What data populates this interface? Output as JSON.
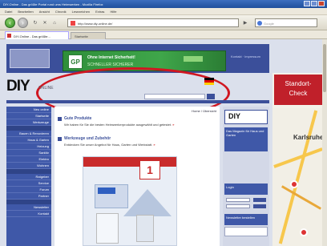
{
  "window": {
    "title": "DIY-Online - Das größte Portal rund ums Heimwerken - Mozilla Firefox"
  },
  "menu": [
    "Datei",
    "Bearbeiten",
    "Ansicht",
    "Chronik",
    "Lesezeichen",
    "Extras",
    "Hilfe"
  ],
  "nav": {
    "url": "http://www.diy-online.de/",
    "search_placeholder": "Google"
  },
  "tabs": [
    {
      "label": "DIY-Online - Das größte..."
    },
    {
      "label": "Startseite"
    }
  ],
  "site": {
    "logo": "DIY",
    "logo_sub": "ONLINE",
    "ad_banner": {
      "logo": "GP",
      "line1": "Ohne Internet Sicherheit!",
      "line2": "SCHNELLER SICHERER"
    },
    "header_link": "Kontakt · Impressum",
    "breadcrumb": "Home / Übersicht",
    "section1": {
      "title": "Gute Produkte",
      "text": "Wir haben für Sie die besten Heimwerkerprodukte ausgewählt und getestet."
    },
    "section2": {
      "title": "Werkzeuge und Zubehör",
      "text": "Entdecken Sie unser Angebot für Haus, Garten und Werkstatt."
    },
    "product_badge": "1",
    "left_nav": [
      "Neu online",
      "Startseite",
      "Werkzeuge",
      "Bauen & Renovieren",
      "Haus & Garten",
      "Heizung",
      "Sanitär",
      "Elektro",
      "Wohnen",
      "Ratgeber",
      "Service",
      "Forum",
      "Partner",
      "Newsletter",
      "Kontakt"
    ],
    "right": {
      "logo": "DIY",
      "box1": "Das Magazin für Haus und Garten",
      "box2": "Login",
      "box3": "Newsletter bestellen"
    }
  },
  "ad_right": {
    "headline_1": "Standort-",
    "headline_2": "Check",
    "map_label": "Karlsruhe"
  },
  "colors": {
    "site_blue": "#3b4f9a",
    "highlight_ellipse": "#d01620",
    "ad_green": "#3fa64a",
    "ad_red": "#c0202a"
  }
}
